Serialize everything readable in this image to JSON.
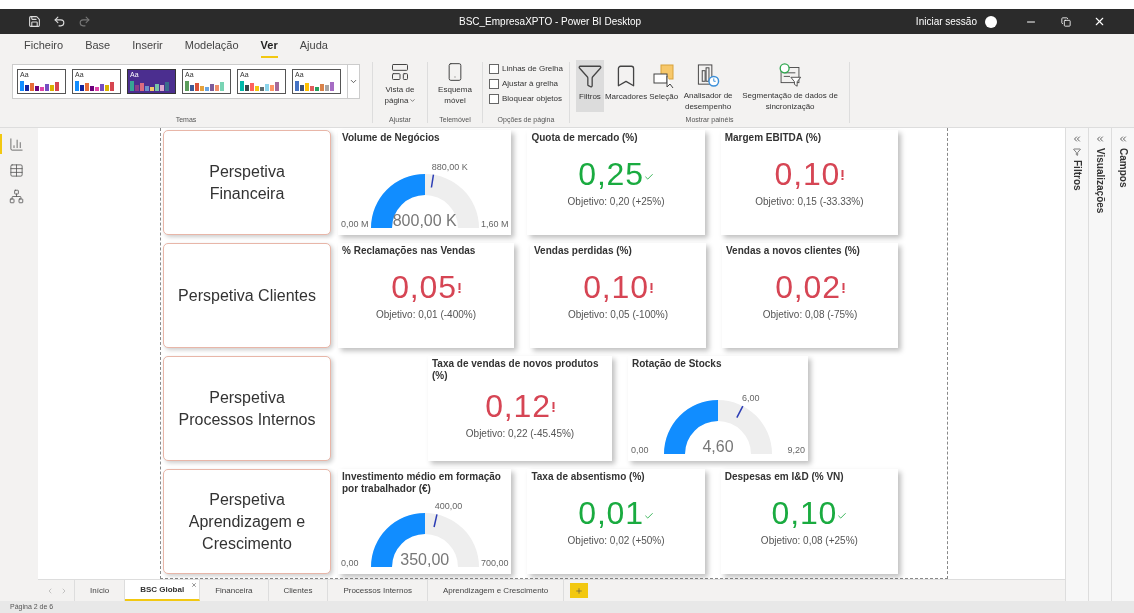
{
  "window": {
    "title": "BSC_EmpresaXPTO - Power BI Desktop",
    "sign_in": "Iniciar sessão"
  },
  "menu": [
    {
      "label": "Ficheiro",
      "selected": false
    },
    {
      "label": "Base",
      "selected": false
    },
    {
      "label": "Inserir",
      "selected": false
    },
    {
      "label": "Modelação",
      "selected": false
    },
    {
      "label": "Ver",
      "selected": true
    },
    {
      "label": "Ajuda",
      "selected": false
    }
  ],
  "ribbon": {
    "themes": {
      "label": "Temas",
      "items": [
        {
          "label": "Aa",
          "selected": false
        },
        {
          "label": "Aa",
          "selected": false
        },
        {
          "label": "Aa",
          "selected": true
        },
        {
          "label": "Aa",
          "selected": false
        },
        {
          "label": "Aa",
          "selected": false
        },
        {
          "label": "Aa",
          "selected": false
        }
      ]
    },
    "fit": {
      "label": "Ajustar",
      "button": "Vista de página"
    },
    "phone": {
      "label": "Telemóvel",
      "button": "Esquema móvel"
    },
    "page_options": {
      "label": "Opções de página",
      "items": [
        {
          "label": "Linhas de Grelha",
          "checked": false
        },
        {
          "label": "Ajustar à grelha",
          "checked": false
        },
        {
          "label": "Bloquear objetos",
          "checked": false
        }
      ]
    },
    "panes": {
      "label": "Mostrar painéis",
      "items": [
        {
          "kind": "filter",
          "label": "Filtros",
          "selected": true
        },
        {
          "kind": "bookmark",
          "label": "Marcadores",
          "selected": false
        },
        {
          "kind": "selection",
          "label": "Seleção",
          "selected": false
        },
        {
          "kind": "performance",
          "label": "Analisador de desempenho",
          "selected": false
        },
        {
          "kind": "sync",
          "label": "Segmentação de dados de sincronização",
          "selected": false
        }
      ]
    }
  },
  "views": [
    {
      "kind": "report",
      "selected": true
    },
    {
      "kind": "data",
      "selected": false
    },
    {
      "kind": "model",
      "selected": false
    }
  ],
  "report": [
    {
      "title": "Perspetiva Financeira",
      "visuals": [
        {
          "kind": "gauge",
          "title": "Volume de Negócios",
          "min": "0,00 M",
          "max": "1,60 M",
          "value": "800,00 K",
          "level": 0.5,
          "target": {
            "label": "880,00 K",
            "level": 0.55
          }
        },
        {
          "kind": "kpi",
          "title": "Quota de mercado (%)",
          "value": "0,25",
          "on_target": true,
          "goal": "Objetivo: 0,20 (+25%)"
        },
        {
          "kind": "kpi",
          "title": "Margem EBITDA (%)",
          "value": "0,10",
          "on_target": false,
          "goal": "Objetivo: 0,15 (-33.33%)"
        }
      ]
    },
    {
      "title": "Perspetiva Clientes",
      "visuals": [
        {
          "kind": "kpi",
          "title": "% Reclamações nas Vendas",
          "value": "0,05",
          "on_target": false,
          "goal": "Objetivo: 0,01 (-400%)"
        },
        {
          "kind": "kpi",
          "title": "Vendas perdidas (%)",
          "value": "0,10",
          "on_target": false,
          "goal": "Objetivo: 0,05 (-100%)"
        },
        {
          "kind": "kpi",
          "title": "Vendas a novos clientes (%)",
          "value": "0,02",
          "on_target": false,
          "goal": "Objetivo: 0,08 (-75%)"
        }
      ]
    },
    {
      "title": "Perspetiva Processos Internos",
      "visuals": [
        {
          "kind": "kpi",
          "title": "Taxa de vendas de novos produtos (%)",
          "value": "0,12",
          "on_target": false,
          "goal": "Objetivo: 0,22 (-45.45%)"
        },
        {
          "kind": "gauge",
          "title": "Rotação de Stocks",
          "min": "0,00",
          "max": "9,20",
          "value": "4,60",
          "level": 0.5,
          "target": {
            "label": "6,00",
            "level": 0.652
          }
        }
      ]
    },
    {
      "title": "Perspetiva Aprendizagem e Crescimento",
      "visuals": [
        {
          "kind": "gauge",
          "title": "Investimento médio em formação por trabalhador (€)",
          "min": "0,00",
          "max": "700,00",
          "value": "350,00",
          "level": 0.5,
          "target": {
            "label": "400,00",
            "level": 0.571
          }
        },
        {
          "kind": "kpi",
          "title": "Taxa de absentismo (%)",
          "value": "0,01",
          "on_target": true,
          "goal": "Objetivo: 0,02 (+50%)"
        },
        {
          "kind": "kpi",
          "title": "Despesas em I&D (% VN)",
          "value": "0,10",
          "on_target": true,
          "goal": "Objetivo: 0,08 (+25%)"
        }
      ]
    }
  ],
  "side_panes": [
    {
      "label": "Filtros",
      "kind": "filter"
    },
    {
      "label": "Visualizações",
      "kind": "plain"
    },
    {
      "label": "Campos",
      "kind": "plain"
    }
  ],
  "page_tabs": [
    {
      "label": "Início",
      "selected": false
    },
    {
      "label": "BSC Global",
      "selected": true
    },
    {
      "label": "Financeira",
      "selected": false
    },
    {
      "label": "Clientes",
      "selected": false
    },
    {
      "label": "Processos Internos",
      "selected": false
    },
    {
      "label": "Aprendizagem e Crescimento",
      "selected": false
    }
  ],
  "status_bar": "Página 2 de 6"
}
